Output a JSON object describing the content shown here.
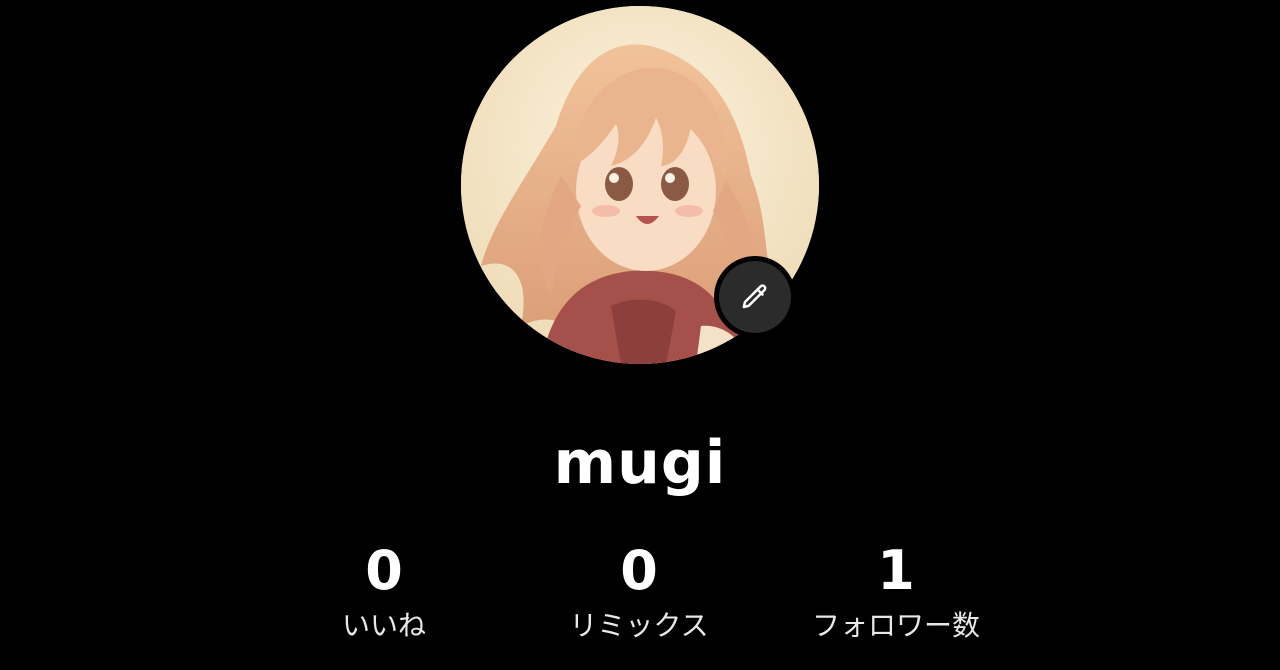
{
  "profile": {
    "username": "mugi",
    "avatar_icon": "anime-girl-avatar",
    "edit_icon": "pencil-icon"
  },
  "stats": [
    {
      "value": "0",
      "label": "いいね"
    },
    {
      "value": "0",
      "label": "リミックス"
    },
    {
      "value": "1",
      "label": "フォロワー数"
    }
  ],
  "colors": {
    "background": "#000000",
    "text": "#ffffff",
    "edit_button": "#2b2b2b",
    "avatar_bg": "#f7ecd3",
    "hair": "#e9b48e"
  }
}
